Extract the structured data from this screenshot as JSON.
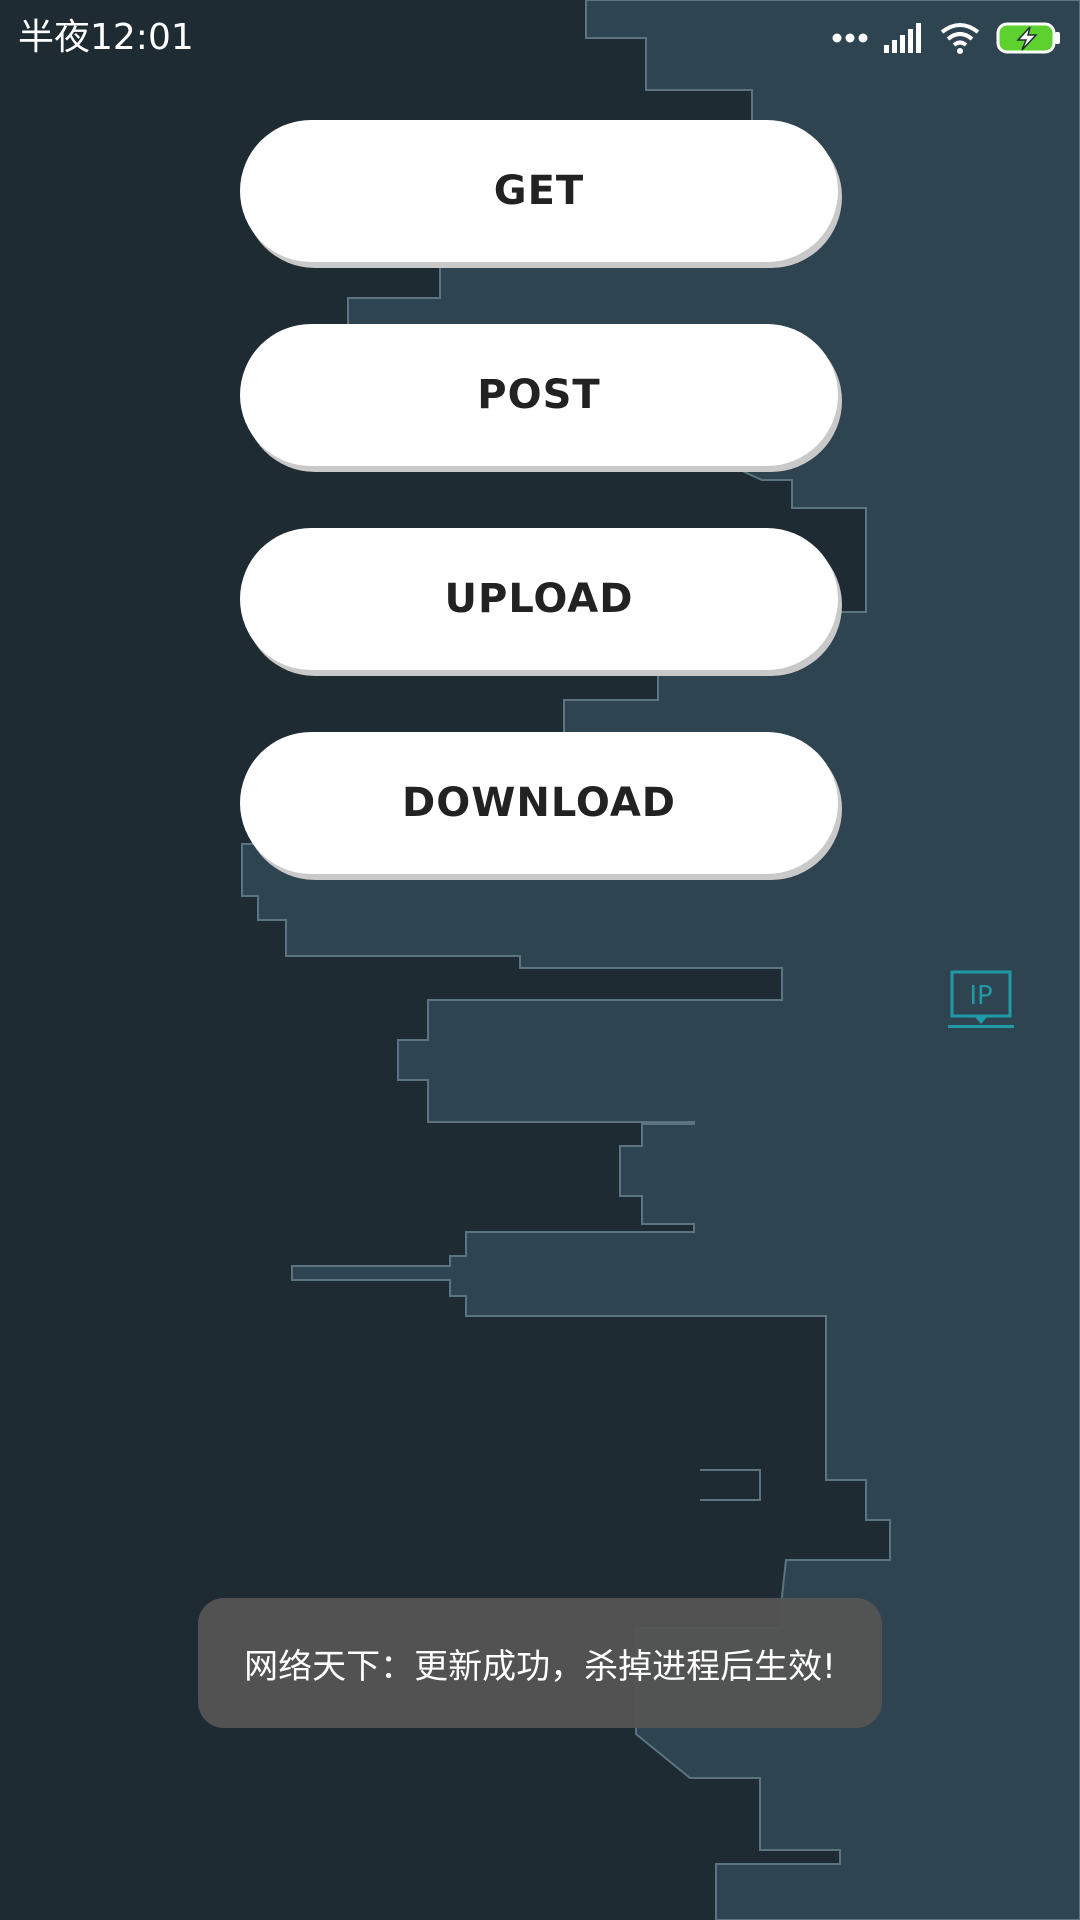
{
  "status_bar": {
    "time": "半夜12:01",
    "icons": [
      "more-dots-icon",
      "signal-icon",
      "wifi-icon",
      "battery-charging-icon"
    ],
    "battery_color": "#5dd22e"
  },
  "buttons": {
    "get_label": "GET",
    "post_label": "POST",
    "upload_label": "UPLOAD",
    "download_label": "DOWNLOAD"
  },
  "ip_widget": {
    "label": "IP",
    "color": "#1f9aa6"
  },
  "toast": {
    "message": "网络天下：更新成功，杀掉进程后生效!"
  },
  "colors": {
    "background_dark": "#1f2b33",
    "background_light": "#2e4450",
    "button_bg": "#ffffff",
    "button_text": "#222222"
  }
}
